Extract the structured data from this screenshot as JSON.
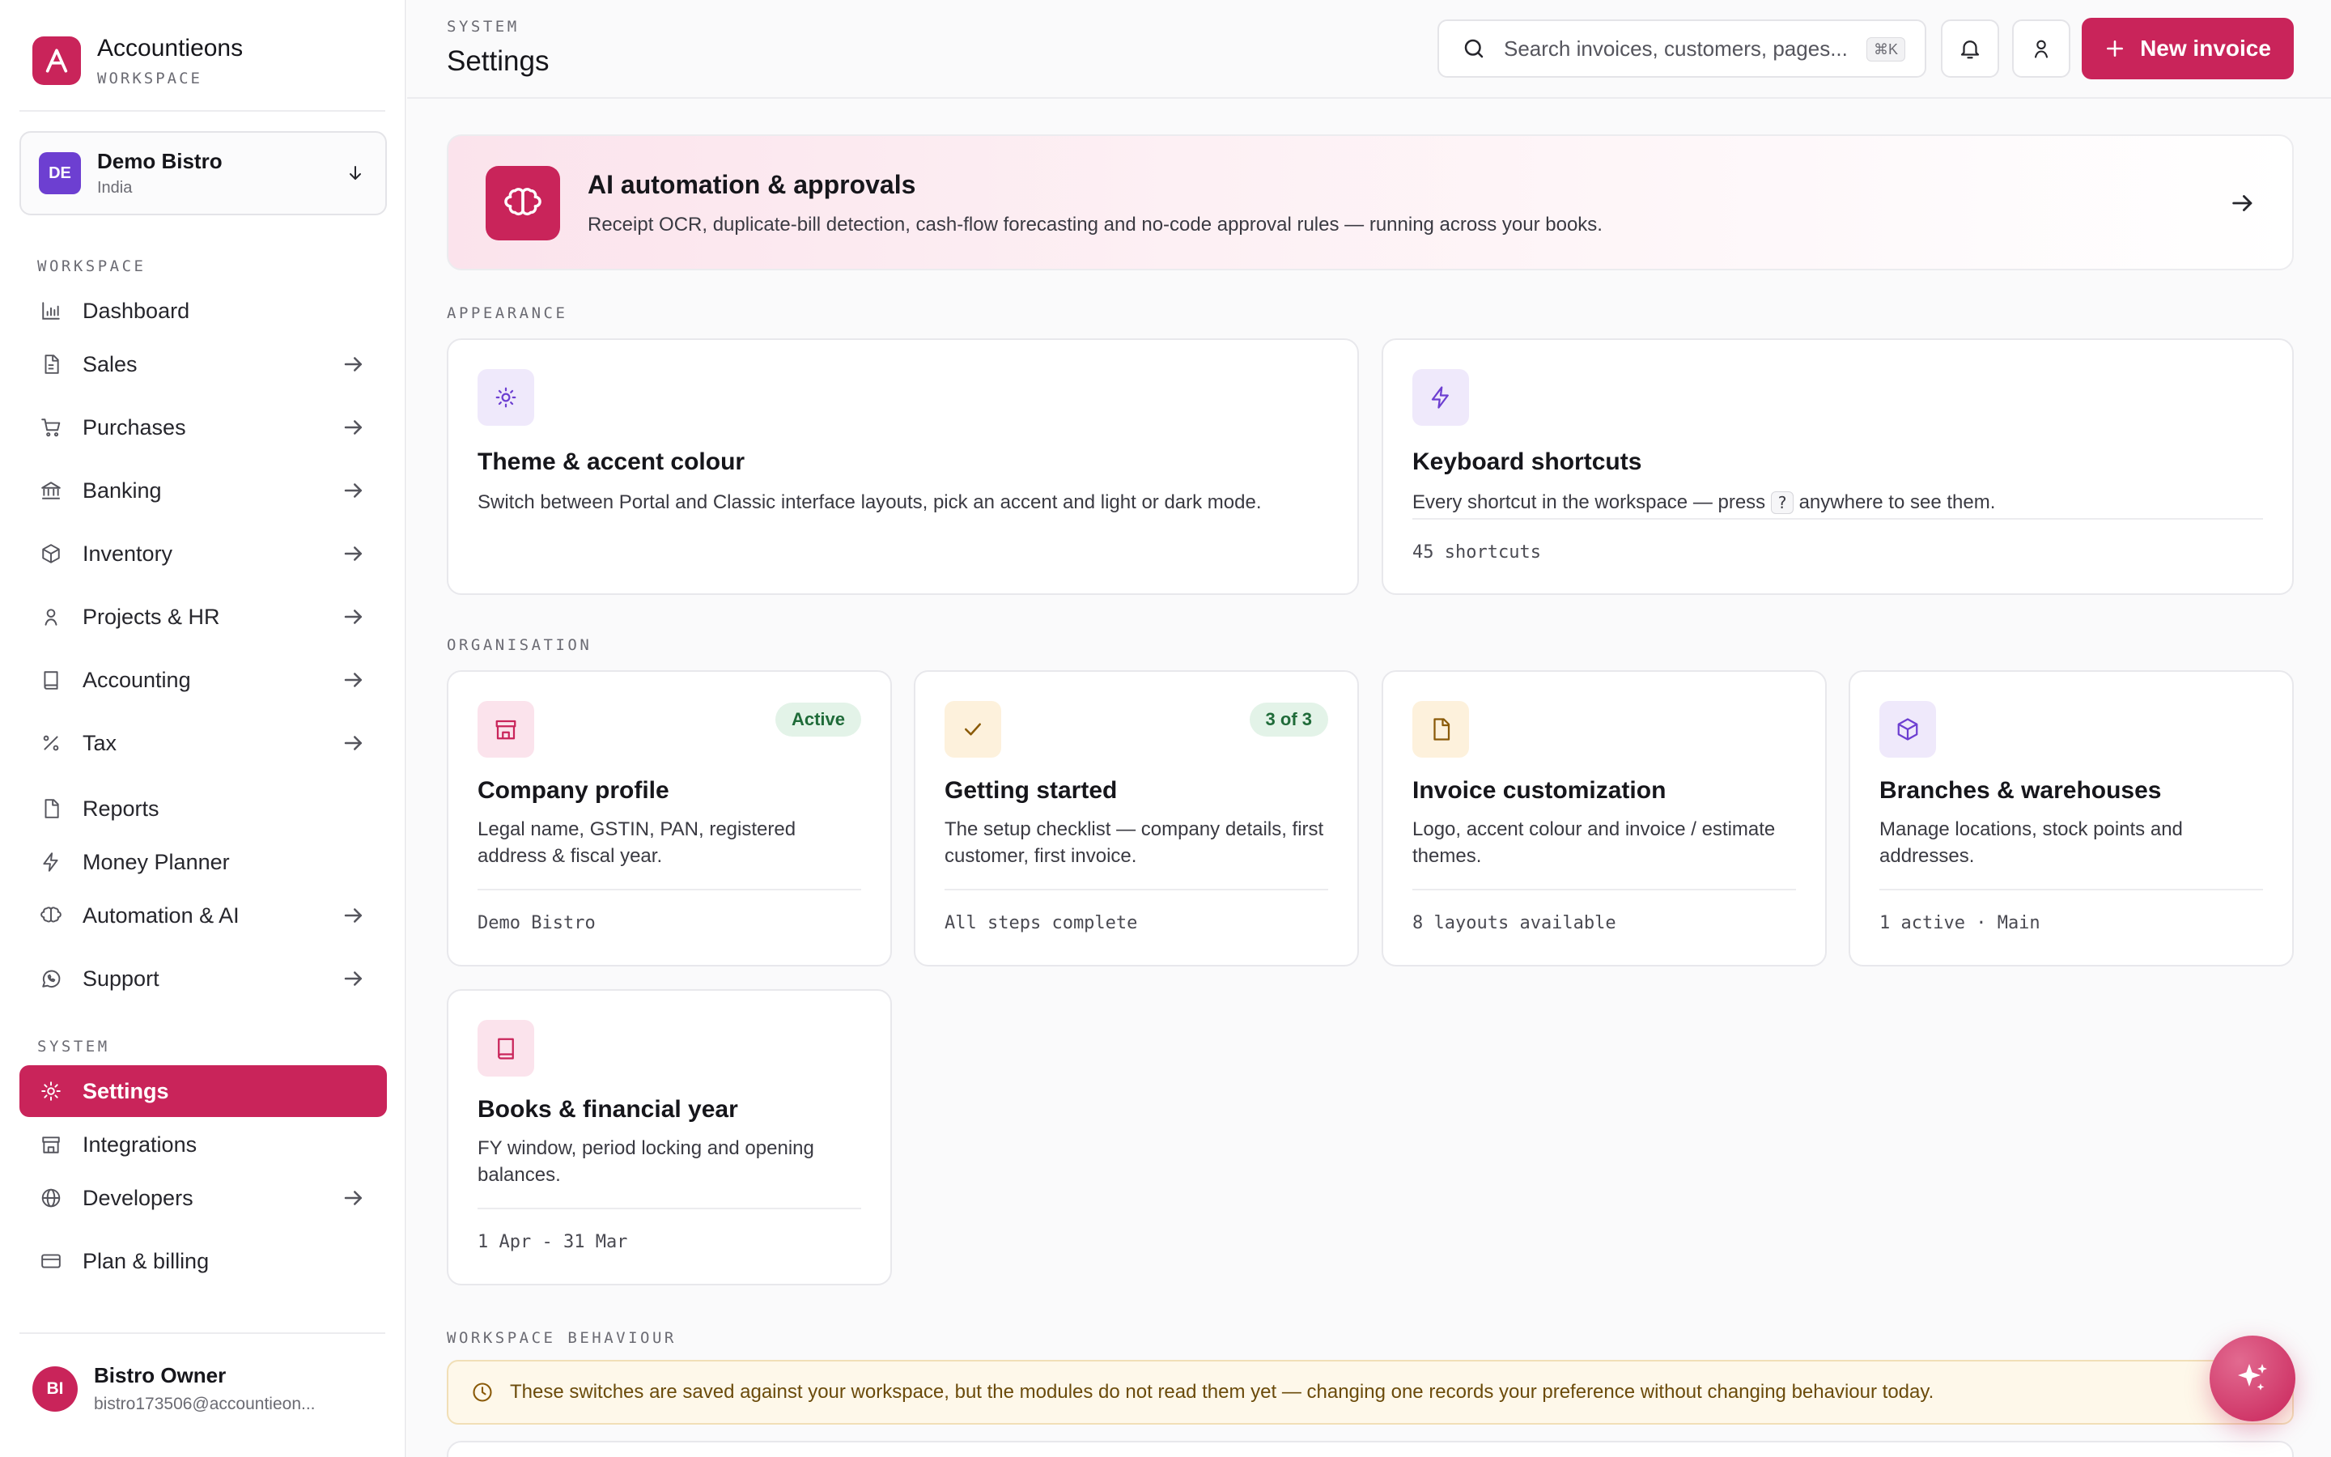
{
  "brand": {
    "name": "Accountieons",
    "sub": "WORKSPACE"
  },
  "org": {
    "initials": "DE",
    "name": "Demo Bistro",
    "country": "India"
  },
  "sidebar": {
    "workspace_label": "WORKSPACE",
    "system_label": "SYSTEM",
    "items": [
      {
        "label": "Dashboard",
        "icon": "bar-chart-icon",
        "has_arrow": false
      },
      {
        "label": "Sales",
        "icon": "document-icon",
        "has_arrow": true
      },
      {
        "label": "Purchases",
        "icon": "cart-icon",
        "has_arrow": true
      },
      {
        "label": "Banking",
        "icon": "bank-icon",
        "has_arrow": true
      },
      {
        "label": "Inventory",
        "icon": "box-icon",
        "has_arrow": true
      },
      {
        "label": "Projects & HR",
        "icon": "person-icon",
        "has_arrow": true
      },
      {
        "label": "Accounting",
        "icon": "book-icon",
        "has_arrow": true
      },
      {
        "label": "Tax",
        "icon": "percent-icon",
        "has_arrow": true
      },
      {
        "label": "Reports",
        "icon": "file-icon",
        "has_arrow": false
      },
      {
        "label": "Money Planner",
        "icon": "lightning-icon",
        "has_arrow": false
      },
      {
        "label": "Automation & AI",
        "icon": "brain-icon",
        "has_arrow": true
      },
      {
        "label": "Support",
        "icon": "chat-icon",
        "has_arrow": true
      }
    ],
    "system_items": [
      {
        "label": "Settings",
        "icon": "gear-icon",
        "active": true
      },
      {
        "label": "Integrations",
        "icon": "store-icon",
        "has_arrow": false
      },
      {
        "label": "Developers",
        "icon": "globe-icon",
        "has_arrow": true
      },
      {
        "label": "Plan & billing",
        "icon": "card-icon",
        "has_arrow": false
      }
    ]
  },
  "user": {
    "initials": "BI",
    "name": "Bistro Owner",
    "email": "bistro173506@accountieon..."
  },
  "header": {
    "crumb": "SYSTEM",
    "title": "Settings",
    "search_placeholder": "Search invoices, customers, pages...",
    "search_shortcut": "⌘K",
    "new_invoice": "New invoice"
  },
  "banner": {
    "title": "AI automation & approvals",
    "desc": "Receipt OCR, duplicate-bill detection, cash-flow forecasting and no-code approval rules — running across your books."
  },
  "sections": {
    "appearance": "APPEARANCE",
    "organisation": "ORGANISATION",
    "behaviour": "WORKSPACE BEHAVIOUR"
  },
  "appearance_cards": {
    "theme": {
      "title": "Theme & accent colour",
      "desc": "Switch between Portal and Classic interface layouts, pick an accent and light or dark mode."
    },
    "shortcuts": {
      "title": "Keyboard shortcuts",
      "desc_pre": "Every shortcut in the workspace — press",
      "key": "?",
      "desc_post": "anywhere to see them.",
      "meta": "45 shortcuts"
    }
  },
  "org_cards": [
    {
      "title": "Company profile",
      "desc": "Legal name, GSTIN, PAN, registered address & fiscal year.",
      "meta": "Demo Bistro",
      "badge": "Active"
    },
    {
      "title": "Getting started",
      "desc": "The setup checklist — company details, first customer, first invoice.",
      "meta": "All steps complete",
      "badge": "3 of 3"
    },
    {
      "title": "Invoice customization",
      "desc": "Logo, accent colour and invoice / estimate themes.",
      "meta": "8 layouts available"
    },
    {
      "title": "Branches & warehouses",
      "desc": "Manage locations, stock points and addresses.",
      "meta": "1 active · Main"
    },
    {
      "title": "Books & financial year",
      "desc": "FY window, period locking and opening balances.",
      "meta": "1 Apr - 31 Mar"
    }
  ],
  "warning": "These switches are saved against your workspace, but the modules do not read them yet — changing one records your preference without changing behaviour today.",
  "colors": {
    "accent": "#c9245a",
    "banner_bg": "#fbe3ec",
    "badge_green": "#e3f3e8",
    "warning_bg": "#fef8ea"
  }
}
